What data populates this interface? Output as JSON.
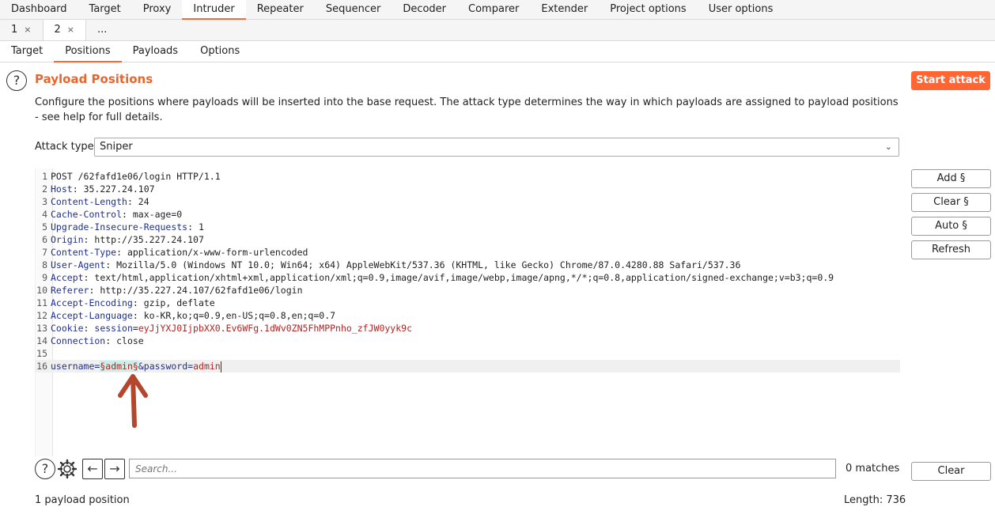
{
  "top_tabs": [
    "Dashboard",
    "Target",
    "Proxy",
    "Intruder",
    "Repeater",
    "Sequencer",
    "Decoder",
    "Comparer",
    "Extender",
    "Project options",
    "User options"
  ],
  "sub_tabs": [
    {
      "label": "1",
      "close": "×"
    },
    {
      "label": "2",
      "close": "×"
    },
    {
      "label": "...",
      "close": ""
    }
  ],
  "intruder_tabs": [
    "Target",
    "Positions",
    "Payloads",
    "Options"
  ],
  "section": {
    "title": "Payload Positions",
    "description": "Configure the positions where payloads will be inserted into the base request. The attack type determines the way in which payloads are assigned to payload positions - see help for full details.",
    "start_label": "Start attack"
  },
  "attack_type": {
    "label": "Attack type:",
    "value": "Sniper"
  },
  "request": {
    "lines": [
      {
        "n": "1",
        "key": "",
        "sep": "",
        "val": "POST /62fafd1e06/login HTTP/1.1"
      },
      {
        "n": "2",
        "key": "Host",
        "sep": ": ",
        "val": "35.227.24.107"
      },
      {
        "n": "3",
        "key": "Content-Length",
        "sep": ": ",
        "val": "24"
      },
      {
        "n": "4",
        "key": "Cache-Control",
        "sep": ": ",
        "val": "max-age=0"
      },
      {
        "n": "5",
        "key": "Upgrade-Insecure-Requests",
        "sep": ": ",
        "val": "1"
      },
      {
        "n": "6",
        "key": "Origin",
        "sep": ": ",
        "val": "http://35.227.24.107"
      },
      {
        "n": "7",
        "key": "Content-Type",
        "sep": ": ",
        "val": "application/x-www-form-urlencoded"
      },
      {
        "n": "8",
        "key": "User-Agent",
        "sep": ": ",
        "val": "Mozilla/5.0 (Windows NT 10.0; Win64; x64) AppleWebKit/537.36 (KHTML, like Gecko) Chrome/87.0.4280.88 Safari/537.36"
      },
      {
        "n": "9",
        "key": "Accept",
        "sep": ": ",
        "val": "text/html,application/xhtml+xml,application/xml;q=0.9,image/avif,image/webp,image/apng,*/*;q=0.8,application/signed-exchange;v=b3;q=0.9"
      },
      {
        "n": "10",
        "key": "Referer",
        "sep": ": ",
        "val": "http://35.227.24.107/62fafd1e06/login"
      },
      {
        "n": "11",
        "key": "Accept-Encoding",
        "sep": ": ",
        "val": "gzip, deflate"
      },
      {
        "n": "12",
        "key": "Accept-Language",
        "sep": ": ",
        "val": "ko-KR,ko;q=0.9,en-US;q=0.8,en;q=0.7"
      },
      {
        "n": "13",
        "key": "Cookie",
        "sep": ": ",
        "val": "",
        "cookie_name": "session",
        "cookie_eq": "=",
        "cookie_val": "eyJjYXJ0IjpbXX0.Ev6WFg.1dWv0ZN5FhMPPnho_zfJW0yyk9c"
      },
      {
        "n": "14",
        "key": "Connection",
        "sep": ": ",
        "val": "close"
      },
      {
        "n": "15",
        "key": "",
        "sep": "",
        "val": ""
      }
    ],
    "body_line": {
      "n": "16",
      "p1_name": "username",
      "p1_eq": "=",
      "marker_open": "§",
      "p1_val": "admin",
      "marker_close": "§",
      "amp": "&",
      "p2_name": "password",
      "p2_eq": "=",
      "p2_val": "admin"
    }
  },
  "side_buttons": {
    "add": "Add §",
    "clear": "Clear §",
    "auto": "Auto §",
    "refresh": "Refresh",
    "clear_bottom": "Clear"
  },
  "search": {
    "placeholder": "Search...",
    "matches": "0 matches"
  },
  "footer": {
    "positions": "1 payload position",
    "length": "Length: 736"
  },
  "colors": {
    "accent": "#ff6633",
    "title": "#e8662c",
    "header_key": "#1e2f8f",
    "value_red": "#b22222",
    "marker_bg": "#cdeee8",
    "arrow": "#b5462e"
  }
}
